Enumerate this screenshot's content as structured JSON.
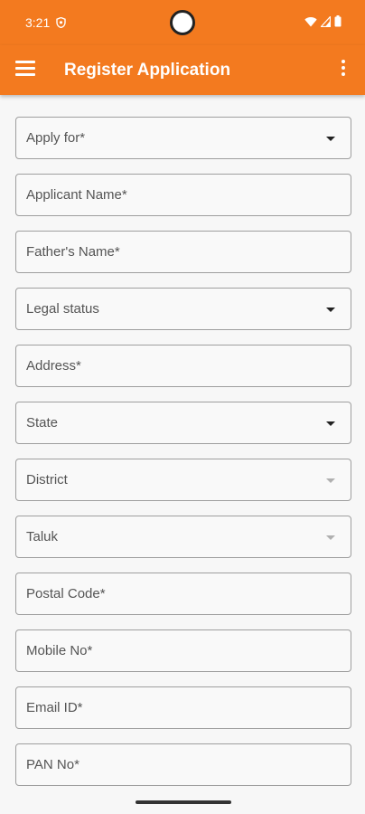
{
  "status_bar": {
    "time": "3:21",
    "left_icon": "shield-icon",
    "right_icons": [
      "wifi-icon",
      "signal-icon",
      "battery-icon"
    ]
  },
  "app_bar": {
    "title": "Register Application",
    "menu_icon": "hamburger-menu-icon",
    "overflow_icon": "more-vert-icon"
  },
  "form": {
    "fields": [
      {
        "label": "Apply for*",
        "type": "dropdown",
        "enabled": true
      },
      {
        "label": "Applicant Name*",
        "type": "text"
      },
      {
        "label": "Father's Name*",
        "type": "text"
      },
      {
        "label": "Legal status",
        "type": "dropdown",
        "enabled": true
      },
      {
        "label": "Address*",
        "type": "text"
      },
      {
        "label": "State",
        "type": "dropdown",
        "enabled": true
      },
      {
        "label": "District",
        "type": "dropdown",
        "enabled": false
      },
      {
        "label": "Taluk",
        "type": "dropdown",
        "enabled": false
      },
      {
        "label": "Postal Code*",
        "type": "text"
      },
      {
        "label": "Mobile No*",
        "type": "text"
      },
      {
        "label": "Email ID*",
        "type": "text"
      },
      {
        "label": "PAN No*",
        "type": "text"
      }
    ]
  },
  "colors": {
    "primary": "#f37a1f",
    "background": "#f7f7f7",
    "field_border": "#9e9e9e",
    "label_text": "#555555"
  }
}
